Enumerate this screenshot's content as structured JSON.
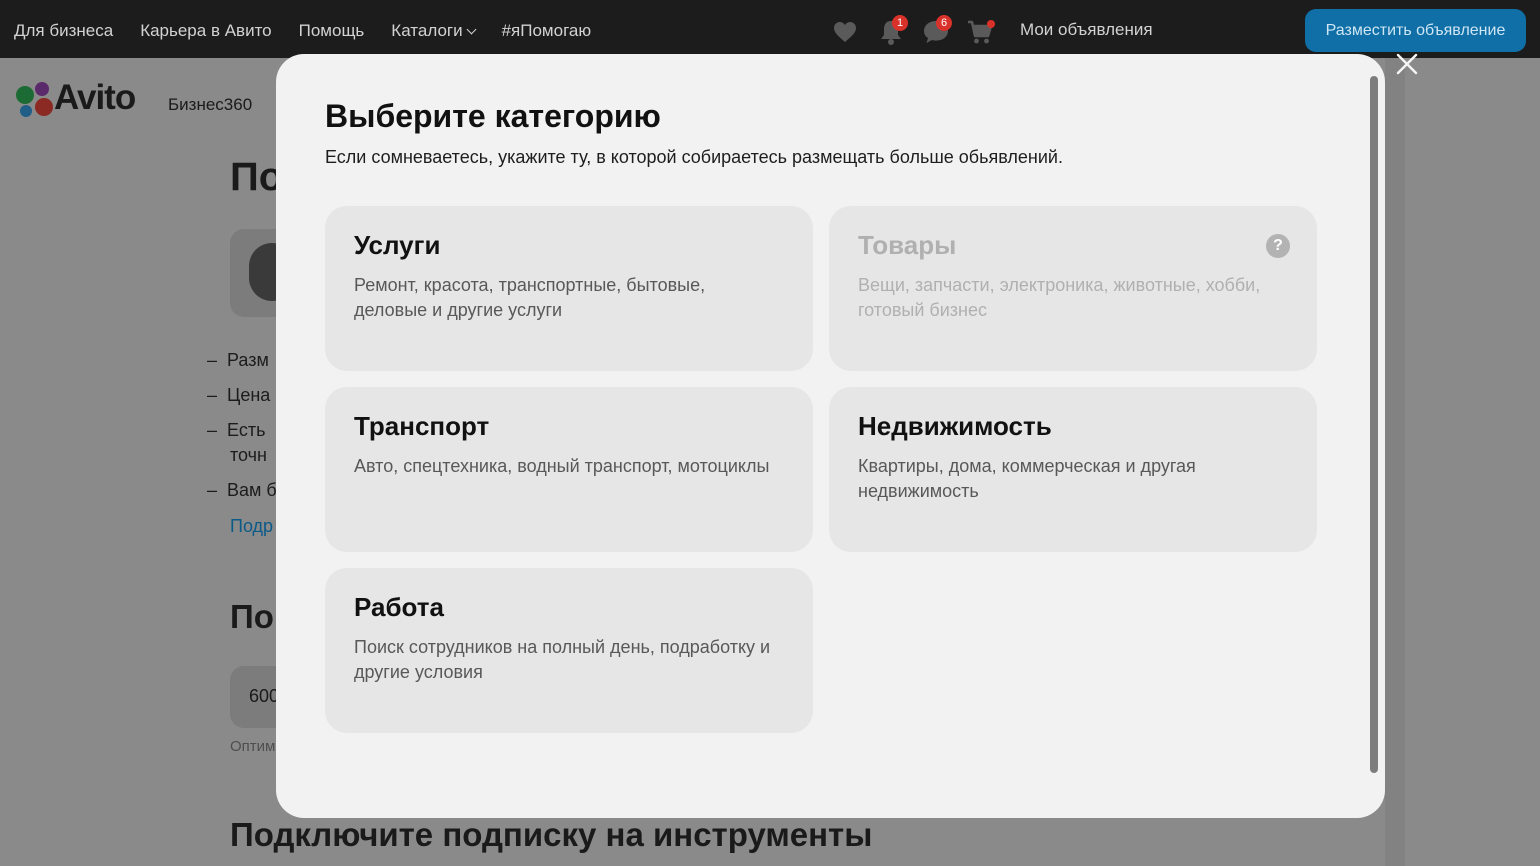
{
  "topnav": {
    "items": [
      "Для бизнеса",
      "Карьера в Авито",
      "Помощь",
      "Каталоги",
      "#яПомогаю"
    ],
    "icons": [
      "heart-icon",
      "bell-icon",
      "chat-icon",
      "cart-icon"
    ],
    "notifications_count": "1",
    "messages_count": "6",
    "my_ads": "Мои объявления",
    "post_button": "Разместить объявление"
  },
  "brand": {
    "logo": "Avito",
    "product": "Бизнес360"
  },
  "background": {
    "heading": "По",
    "list": [
      "Разм",
      "Цена",
      "Есть",
      "точн",
      "Вам б"
    ],
    "link": "Подр",
    "heading2": "По",
    "input_value": "600",
    "hint": "Оптим",
    "heading3": "Подключите подписку на инструменты"
  },
  "modal": {
    "title": "Выберите категорию",
    "subtitle": "Если сомневаетесь, укажите ту, в которой собираетесь размещать больше обьявлений.",
    "categories": [
      {
        "title": "Услуги",
        "description": "Ремонт, красота, транспортные, бытовые, деловые и другие услуги"
      },
      {
        "title": "Товары",
        "description": "Вещи, запчасти, электроника, животные, хобби, готовый бизнес",
        "help": "?"
      },
      {
        "title": "Транспорт",
        "description": "Авто, спецтехника, водный транспорт, мотоциклы"
      },
      {
        "title": "Недвижимость",
        "description": "Квартиры, дома, коммерческая и другая недвижимость"
      },
      {
        "title": "Работа",
        "description": "Поиск сотрудников на полный день, подработку и другие условия"
      }
    ]
  },
  "colors": {
    "topbar": "#1c1c1c",
    "accent_button": "#0f6fa6",
    "badge": "#d9322b",
    "modal_bg": "#f2f2f2",
    "card_bg": "#e6e6e6",
    "link": "#0b5a87"
  }
}
